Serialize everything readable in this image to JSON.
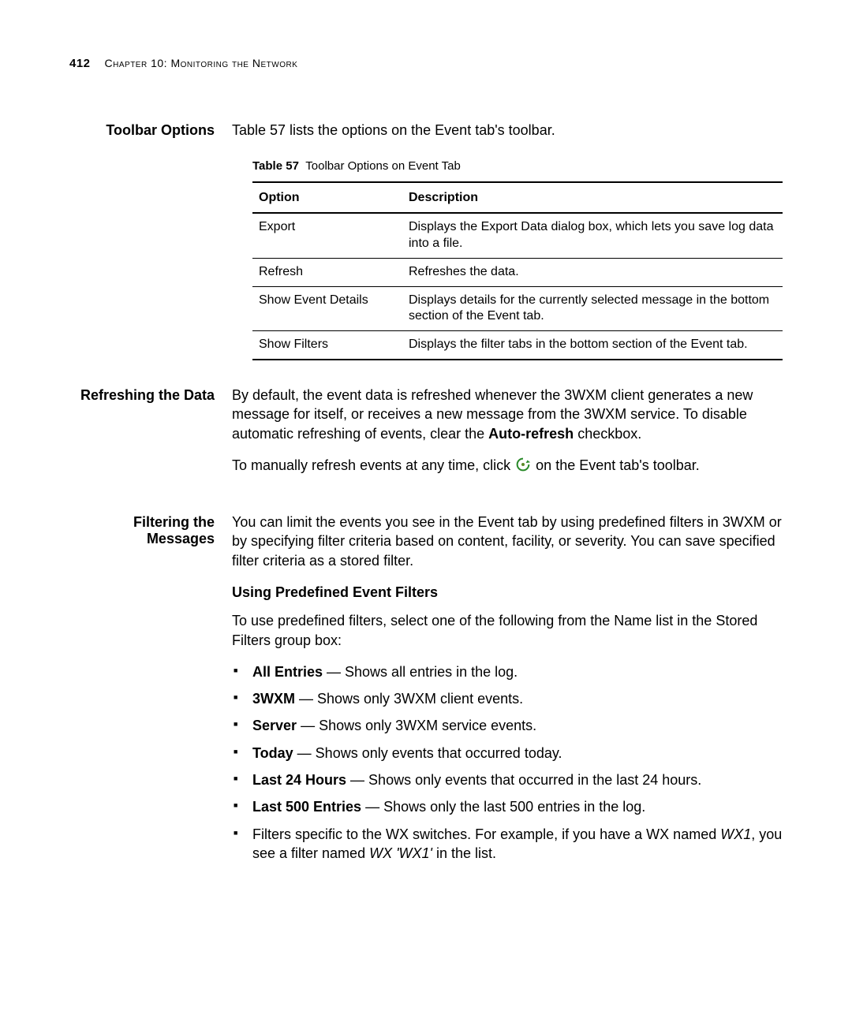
{
  "header": {
    "page_number": "412",
    "chapter": "Chapter 10: Monitoring the Network"
  },
  "sections": {
    "toolbar_options": {
      "label": "Toolbar Options",
      "intro": "Table 57 lists the options on the Event tab's toolbar.",
      "table_caption_num": "Table 57",
      "table_caption_text": "Toolbar Options on Event Tab",
      "col1": "Option",
      "col2": "Description",
      "rows": [
        {
          "option": "Export",
          "desc": "Displays the Export Data dialog box, which lets you save log data into a file."
        },
        {
          "option": "Refresh",
          "desc": "Refreshes the data."
        },
        {
          "option": "Show Event Details",
          "desc": "Displays details for the currently selected message in the bottom section of the Event tab."
        },
        {
          "option": "Show Filters",
          "desc": "Displays the filter tabs in the bottom section of the Event tab."
        }
      ]
    },
    "refreshing": {
      "label": "Refreshing the Data",
      "p1_a": "By default, the event data is refreshed whenever the 3WXM client generates a new message for itself, or receives a new message from the 3WXM service. To disable automatic refreshing of events, clear the ",
      "p1_bold": "Auto-refresh",
      "p1_b": " checkbox.",
      "p2_a": "To manually refresh events at any time, click ",
      "p2_b": " on the Event tab's toolbar."
    },
    "filtering": {
      "label_line1": "Filtering the",
      "label_line2": "Messages",
      "p1": "You can limit the events you see in the Event tab by using predefined filters in 3WXM or by specifying filter criteria based on content, facility, or severity. You can save specified filter criteria as a stored filter.",
      "subhead": "Using Predefined Event Filters",
      "p2": "To use predefined filters, select one of the following from the Name list in the Stored Filters group box:",
      "bullets": [
        {
          "bold": "All Entries",
          "rest": " — Shows all entries in the log."
        },
        {
          "bold": "3WXM",
          "rest": " — Shows only 3WXM client events."
        },
        {
          "bold": "Server",
          "rest": " — Shows only 3WXM service events."
        },
        {
          "bold": "Today",
          "rest": " — Shows only events that occurred today."
        },
        {
          "bold": "Last 24 Hours",
          "rest": " — Shows only events that occurred in the last 24 hours."
        },
        {
          "bold": "Last 500 Entries",
          "rest": " — Shows only the last 500 entries in the log."
        }
      ],
      "wx_a": "Filters specific to the WX switches. For example, if you have a WX named ",
      "wx_i1": "WX1",
      "wx_b": ", you see a filter named ",
      "wx_i2": "WX 'WX1'",
      "wx_c": " in the list."
    }
  }
}
